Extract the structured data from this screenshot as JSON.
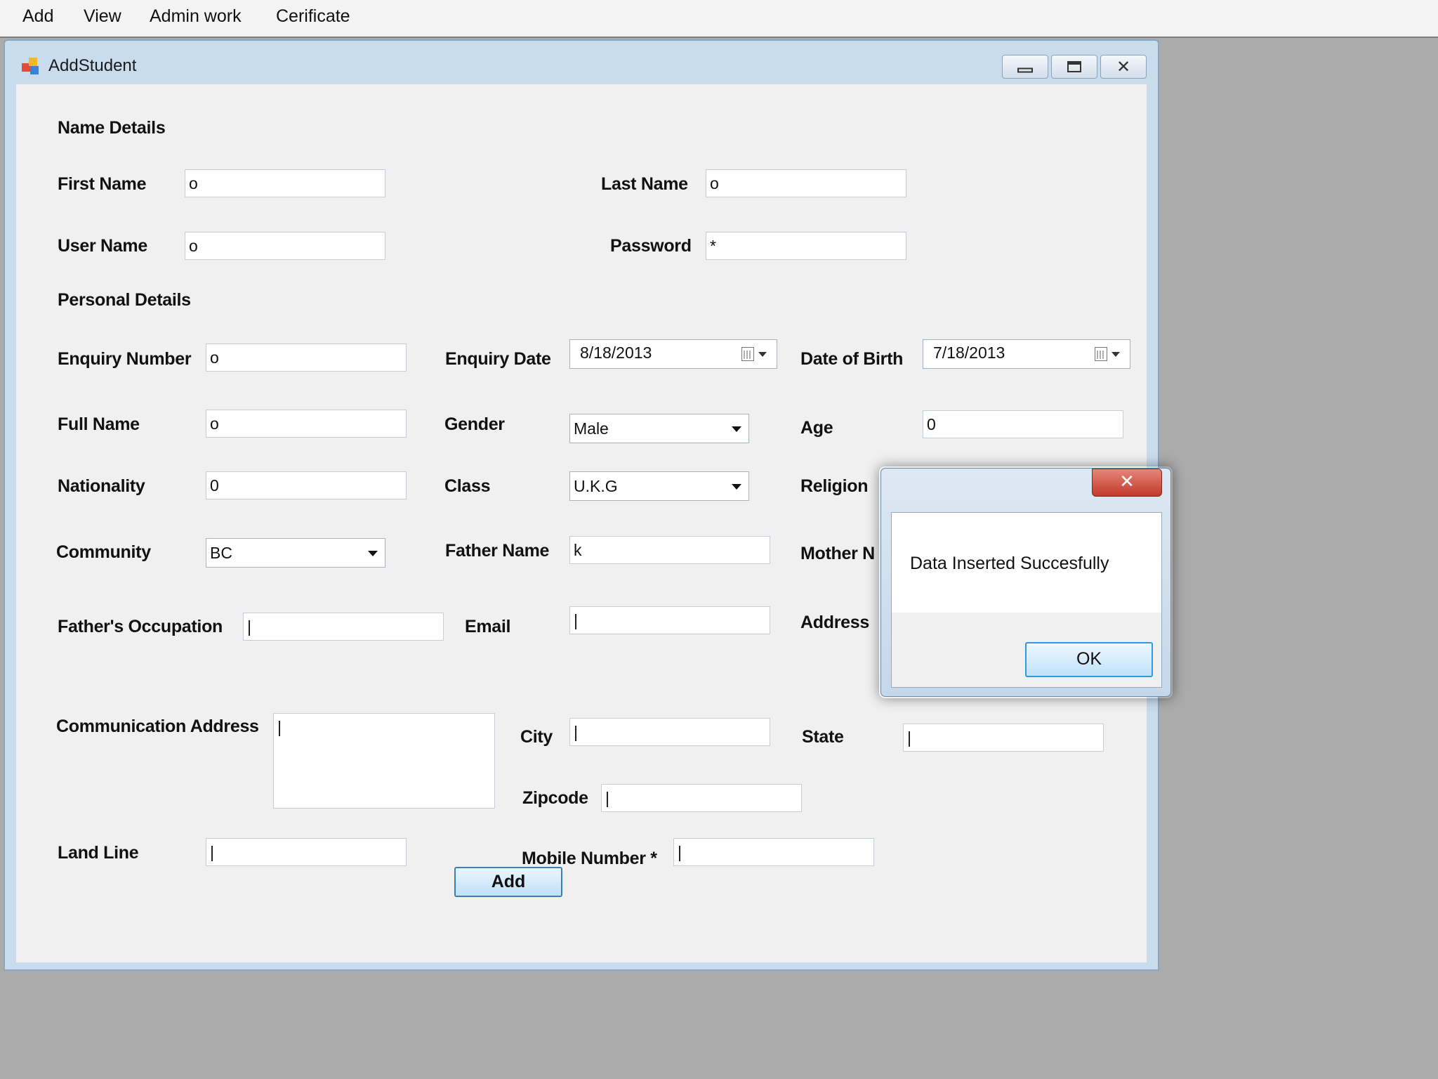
{
  "menu": {
    "items": [
      "Add",
      "View",
      "Admin work",
      "Cerificate"
    ]
  },
  "window": {
    "title": "AddStudent"
  },
  "form": {
    "name_details": "Name Details",
    "first_name_label": "First Name",
    "first_name_value": "o",
    "last_name_label": "Last Name",
    "last_name_value": "o",
    "user_name_label": "User Name",
    "user_name_value": "o",
    "password_label": "Password",
    "password_value": "*",
    "personal_details": "Personal Details",
    "enquiry_number_label": "Enquiry Number",
    "enquiry_number_value": "o",
    "enquiry_date_label": "Enquiry Date",
    "enquiry_date_value": "8/18/2013",
    "dob_label": "Date of Birth",
    "dob_value": "7/18/2013",
    "full_name_label": "Full Name",
    "full_name_value": "o",
    "gender_label": "Gender",
    "gender_value": "Male",
    "age_label": "Age",
    "age_value": "0",
    "nationality_label": "Nationality",
    "nationality_value": "0",
    "class_label": "Class",
    "class_value": "U.K.G",
    "religion_label": "Religion",
    "community_label": "Community",
    "community_value": "BC",
    "father_name_label": "Father Name",
    "father_name_value": "k",
    "mother_name_label": "Mother N",
    "father_occupation_label": "Father's Occupation",
    "father_occupation_value": "|",
    "email_label": "Email",
    "email_value": "|",
    "address_label": "Address",
    "comm_address_label": "Communication Address",
    "comm_address_value": "|",
    "city_label": "City",
    "city_value": "|",
    "state_label": "State",
    "state_value": "|",
    "zipcode_label": "Zipcode",
    "zipcode_value": "|",
    "land_line_label": "Land Line",
    "land_line_value": "|",
    "mobile_label": "Mobile Number *",
    "mobile_value": "|",
    "add_button": "Add"
  },
  "dialog": {
    "close_glyph": "✕",
    "message": "Data Inserted Succesfully",
    "ok_button": "OK"
  },
  "colors": {
    "window_frame": "#c9dcee",
    "client_bg": "#f0f0f1",
    "close_red": "#c2392a",
    "button_accent": "#3399dd"
  }
}
